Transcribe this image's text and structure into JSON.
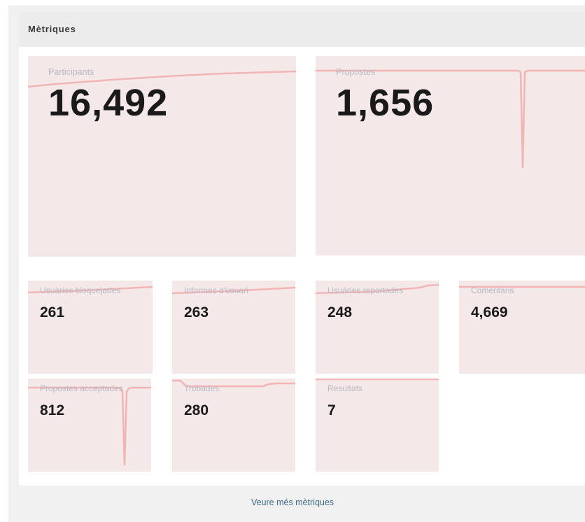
{
  "metrics_panel": {
    "title": "Mètriques",
    "big": [
      {
        "label": "Participants",
        "value": "16,492"
      },
      {
        "label": "Propostes",
        "value": "1,656"
      }
    ],
    "small": [
      {
        "label": "Usuàries bloquejades",
        "value": "261"
      },
      {
        "label": "Informes d'usuari",
        "value": "263"
      },
      {
        "label": "Usuàries reportades",
        "value": "248"
      },
      {
        "label": "Comentaris",
        "value": "4,669"
      },
      {
        "label": "Propostes acceptades",
        "value": "812"
      },
      {
        "label": "Trobades",
        "value": "280"
      },
      {
        "label": "Resultats",
        "value": "7"
      }
    ],
    "sparkline_color": "#f1b5b5",
    "card_background": "#f4e8e8"
  },
  "footer": {
    "more_link": "Veure més mètriques"
  }
}
